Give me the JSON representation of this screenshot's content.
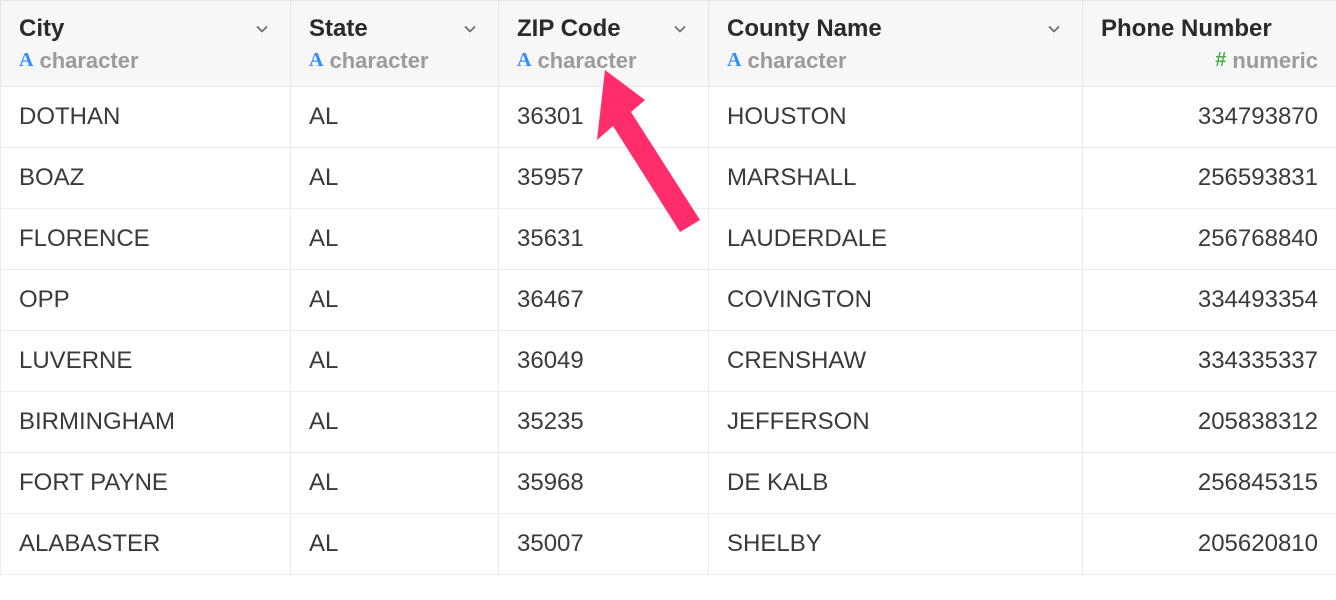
{
  "columns": [
    {
      "name": "City",
      "type_label": "character",
      "type_kind": "char",
      "align": "left"
    },
    {
      "name": "State",
      "type_label": "character",
      "type_kind": "char",
      "align": "left"
    },
    {
      "name": "ZIP Code",
      "type_label": "character",
      "type_kind": "char",
      "align": "left"
    },
    {
      "name": "County Name",
      "type_label": "character",
      "type_kind": "char",
      "align": "left"
    },
    {
      "name": "Phone Number",
      "type_label": "numeric",
      "type_kind": "num",
      "align": "right"
    }
  ],
  "rows": [
    {
      "city": "DOTHAN",
      "state": "AL",
      "zip": "36301",
      "county": "HOUSTON",
      "phone": "334793870"
    },
    {
      "city": "BOAZ",
      "state": "AL",
      "zip": "35957",
      "county": "MARSHALL",
      "phone": "256593831"
    },
    {
      "city": "FLORENCE",
      "state": "AL",
      "zip": "35631",
      "county": "LAUDERDALE",
      "phone": "256768840"
    },
    {
      "city": "OPP",
      "state": "AL",
      "zip": "36467",
      "county": "COVINGTON",
      "phone": "334493354"
    },
    {
      "city": "LUVERNE",
      "state": "AL",
      "zip": "36049",
      "county": "CRENSHAW",
      "phone": "334335337"
    },
    {
      "city": "BIRMINGHAM",
      "state": "AL",
      "zip": "35235",
      "county": "JEFFERSON",
      "phone": "205838312"
    },
    {
      "city": "FORT PAYNE",
      "state": "AL",
      "zip": "35968",
      "county": "DE KALB",
      "phone": "256845315"
    },
    {
      "city": "ALABASTER",
      "state": "AL",
      "zip": "35007",
      "county": "SHELBY",
      "phone": "205620810"
    }
  ],
  "type_glyph": {
    "char": "A",
    "num": "#"
  }
}
